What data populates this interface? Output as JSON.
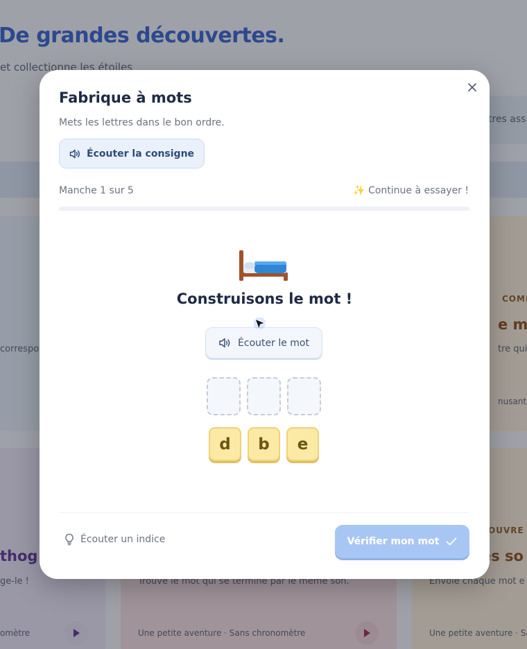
{
  "background": {
    "headline": "De grandes découvertes.",
    "subline": "et collectionne les étoiles",
    "right_chip": "tres ass",
    "card_l1_text": "correspo",
    "card_r1_caption": "COMPLÈ",
    "card_r1_title": "e ma",
    "card_r1_text": "tre qui c",
    "card_r1_footer": "nusantes",
    "card_l2_title": "thog",
    "card_l2_text": "ge-le !",
    "card_l2_footer": "omètre",
    "card_m2_text": "Trouve le mot qui se termine par le même son.",
    "card_m2_footer": "Une petite aventure · Sans chronomètre",
    "card_r2_caption": "OUVRE",
    "card_r2_title": "es so",
    "card_r2_text": "Envoie chaque mot e",
    "card_r2_footer": "Une petite aventure · Sans chronomètre"
  },
  "modal": {
    "title": "Fabrique à mots",
    "subtitle": "Mets les lettres dans le bon ordre.",
    "listen_instruction": "Écouter la consigne",
    "round_label": "Manche 1 sur 5",
    "encouragement": "✨ Continue à essayer !",
    "progress_fraction": 0,
    "prompt": "Construisons le mot !",
    "listen_word": "Écouter le mot",
    "slots": [
      "",
      "",
      ""
    ],
    "tiles": [
      "d",
      "b",
      "e"
    ],
    "hint": "Écouter un indice",
    "verify": "Vérifier mon mot"
  },
  "icons": [
    "speaker-icon",
    "bed-icon",
    "bulb-icon",
    "check-icon",
    "close-icon",
    "play-icon",
    "cursor-icon"
  ],
  "colors": {
    "accent": "#3b82f6",
    "tile": "#fbe9a6",
    "verify_disabled": "#a8c6f4"
  }
}
